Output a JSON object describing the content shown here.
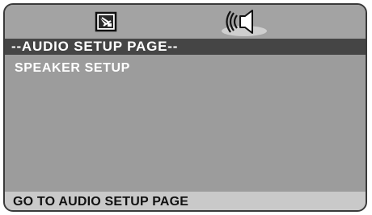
{
  "tabs": [
    {
      "icon": "general-setup-icon",
      "active": false
    },
    {
      "icon": "speaker-icon",
      "active": true
    }
  ],
  "header": {
    "title": "--AUDIO SETUP PAGE--"
  },
  "menu": {
    "items": [
      {
        "label": "SPEAKER SETUP"
      }
    ]
  },
  "status": {
    "text": "GO TO AUDIO SETUP PAGE"
  },
  "colors": {
    "panel": "#9c9c9c",
    "header_bar": "#454545",
    "status_bar": "#c9c9c9",
    "text_light": "#ffffff",
    "text_dark": "#111111"
  }
}
